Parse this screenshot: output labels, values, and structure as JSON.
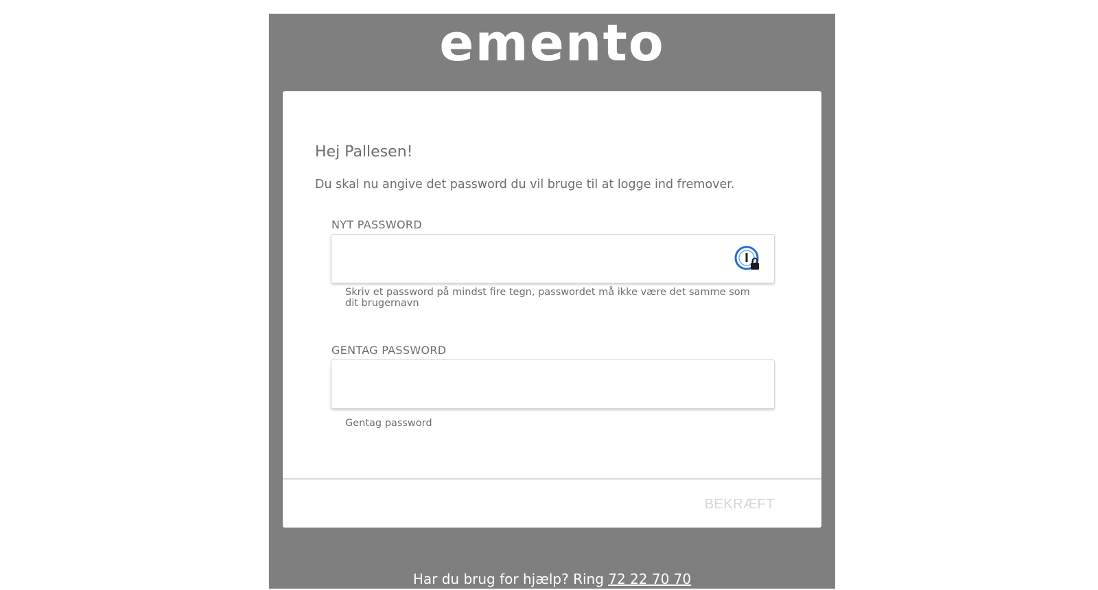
{
  "brand": {
    "logo_text": "emento"
  },
  "card": {
    "greeting": "Hej Pallesen!",
    "intro": "Du skal nu angive det password du vil bruge til at logge ind fremover."
  },
  "new_password": {
    "label": "NYT PASSWORD",
    "value": "",
    "hint": "Skriv et password på mindst fire tegn, passwordet må ikke være det samme som dit brugernavn",
    "icon": "password-manager-icon"
  },
  "repeat_password": {
    "label": "GENTAG PASSWORD",
    "value": "",
    "hint": "Gentag password"
  },
  "actions": {
    "confirm_label": "BEKRÆFT"
  },
  "footer": {
    "help_text": "Har du brug for hjælp? Ring",
    "phone": "72 22 70 70"
  },
  "colors": {
    "background_frame": "#7f7f7f",
    "card": "#ffffff",
    "text": "#6d6d6d",
    "disabled_button": "#d6d6d6",
    "icon_blue": "#1f6fd8"
  }
}
